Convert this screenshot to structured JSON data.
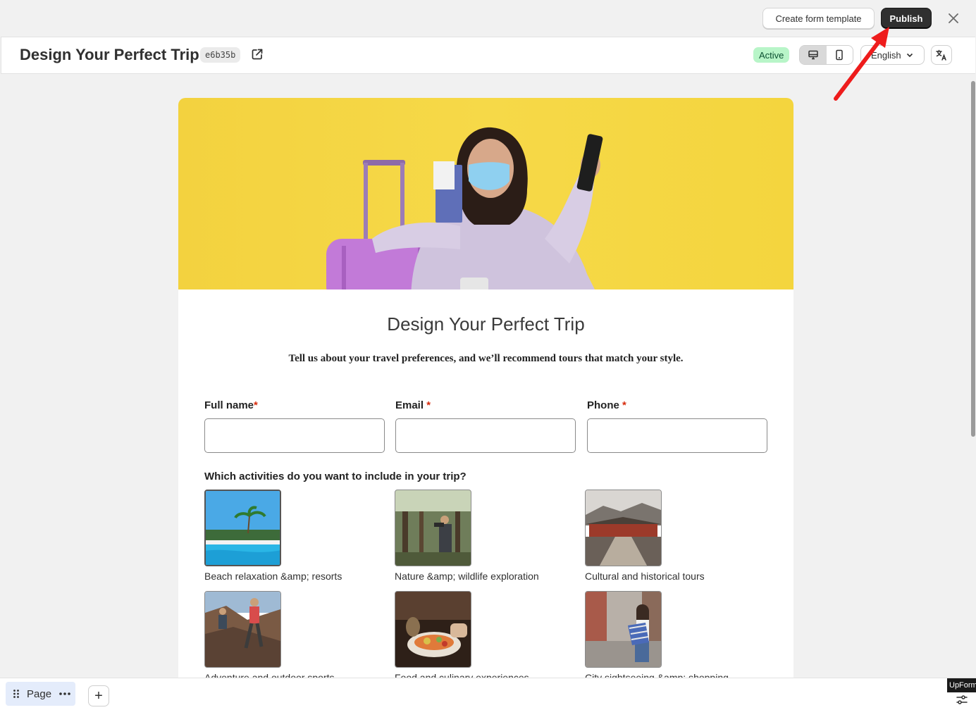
{
  "topbar": {
    "create_template_label": "Create form template",
    "publish_label": "Publish",
    "close_glyph": "✕"
  },
  "header": {
    "title": "Design Your Perfect Trip",
    "form_id": "e6b35b",
    "status": "Active",
    "language": "English"
  },
  "form": {
    "title": "Design Your Perfect Trip",
    "subtitle": "Tell us about your travel preferences, and we’ll recommend tours that match your style.",
    "fields": [
      {
        "label": "Full name",
        "required": "*",
        "value": ""
      },
      {
        "label": "Email",
        "required": "*",
        "value": ""
      },
      {
        "label": "Phone",
        "required": "*",
        "value": ""
      }
    ],
    "question": "Which activities do you want to include in your trip?",
    "choices": [
      {
        "label": "Beach relaxation &amp; resorts",
        "image": "beach-resort",
        "selected": true
      },
      {
        "label": "Nature &amp; wildlife exploration",
        "image": "forest-hiker",
        "selected": false
      },
      {
        "label": "Cultural and historical tours",
        "image": "temple",
        "selected": false
      },
      {
        "label": "Adventure and outdoor sports",
        "image": "climbers",
        "selected": false
      },
      {
        "label": "Food and culinary experiences",
        "image": "dinner-table",
        "selected": false
      },
      {
        "label": "City sightseeing &amp; shopping",
        "image": "shopping-street",
        "selected": false
      }
    ]
  },
  "bottombar": {
    "page_label": "Page",
    "add_glyph": "+",
    "upform_label": "UpForm"
  },
  "colors": {
    "publish_bg": "#303030",
    "status_bg": "#b8f5c8",
    "status_text": "#0c5132",
    "banner_yellow": "#f4d53e",
    "required": "#d72c0d",
    "annotation_arrow": "#ee1c1c"
  }
}
